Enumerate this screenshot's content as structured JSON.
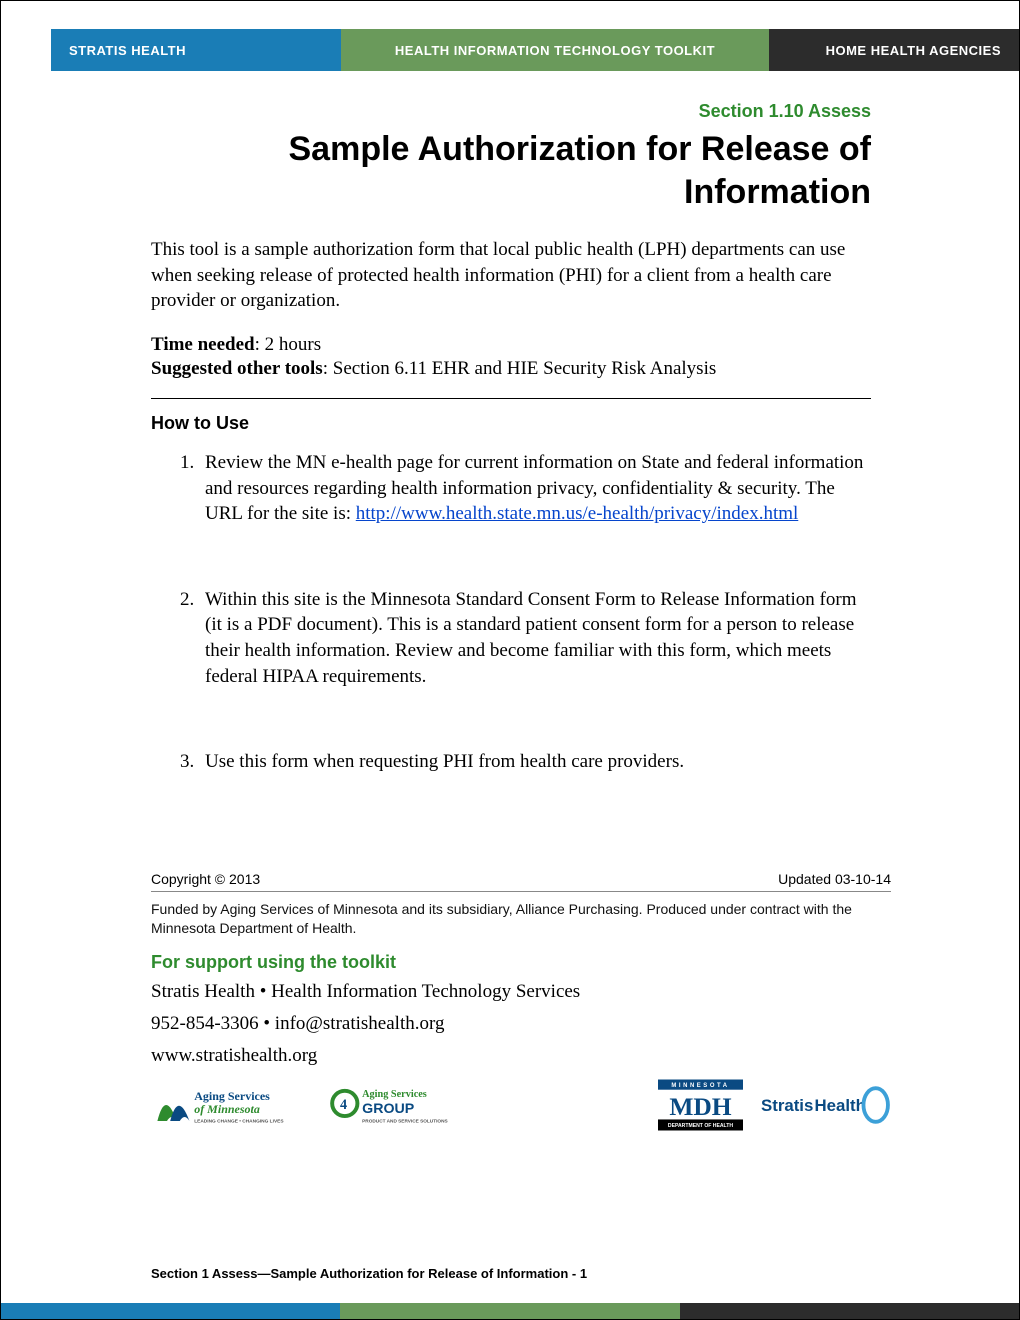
{
  "header": {
    "left": "STRATIS HEALTH",
    "center": "HEALTH INFORMATION TECHNOLOGY TOOLKIT",
    "right": "HOME HEALTH AGENCIES"
  },
  "section_label": "Section 1.10 Assess",
  "title": "Sample Authorization for Release of Information",
  "intro": "This tool is a sample authorization form that local public health (LPH) departments can use when seeking release of protected health information (PHI) for a client from a health care provider or organization.",
  "time_needed_label": "Time needed",
  "time_needed_value": ": 2 hours",
  "suggested_label": "Suggested other tools",
  "suggested_value": ": Section 6.11 EHR and HIE Security Risk Analysis",
  "how_to_use": "How to Use",
  "steps": {
    "s1_pre": "Review the MN e-health page for current information on State and federal information and resources regarding health information privacy, confidentiality & security.  The URL for the site is: ",
    "s1_link": "http://www.health.state.mn.us/e-health/privacy/index.html",
    "s2": "Within this site is the Minnesota Standard Consent Form to Release Information form (it is a PDF document).  This is a standard patient consent form for a person to release their health information.  Review and become familiar with this form, which meets federal HIPAA requirements.",
    "s3": "Use this form when requesting PHI from health care providers."
  },
  "copyright": "Copyright © 2013",
  "updated": "Updated 03-10-14",
  "funded": "Funded by Aging Services of Minnesota and its subsidiary, Alliance Purchasing. Produced under contract with the Minnesota Department of Health.",
  "support_heading": "For support using the toolkit",
  "support_line1": "Stratis Health • Health Information Technology Services",
  "support_line2": "952-854-3306 • info@stratishealth.org",
  "support_line3": "www.stratishealth.org",
  "logos": {
    "asm": "Aging Services of Minnesota",
    "asm_tag": "LEADING CHANGE • CHANGING LIVES",
    "asg": "Aging Services GROUP",
    "asg_tag": "PRODUCT AND SERVICE SOLUTIONS",
    "mdh_top": "MINNESOTA",
    "mdh_mid": "MDH",
    "mdh_bot": "DEPARTMENT OF HEALTH",
    "stratis": "StratisHealth"
  },
  "page_foot": "Section 1 Assess—Sample Authorization for Release of Information - 1"
}
